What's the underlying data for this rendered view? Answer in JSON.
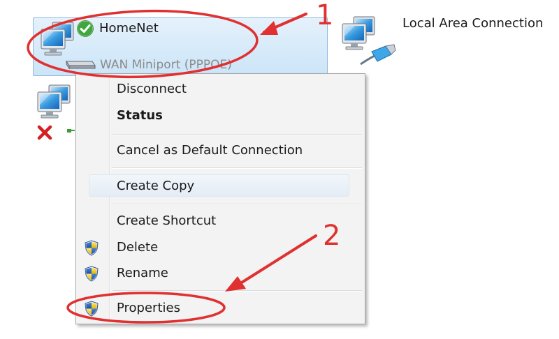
{
  "connections": {
    "selected": {
      "name": "HomeNet",
      "device": "WAN Miniport (PPPOE)",
      "status_icon": "green-check-icon"
    },
    "other": {
      "name": "Local Area Connection",
      "icon": "network-cable-icon"
    },
    "disconnected": {
      "status_icon": "red-x-icon"
    }
  },
  "context_menu": {
    "items": [
      {
        "label": "Disconnect"
      },
      {
        "label": "Status"
      },
      {
        "label": "Cancel as Default Connection"
      },
      {
        "label": "Create Copy"
      },
      {
        "label": "Create Shortcut"
      },
      {
        "label": "Delete",
        "icon": "uac-shield-icon"
      },
      {
        "label": "Rename",
        "icon": "uac-shield-icon"
      },
      {
        "label": "Properties",
        "icon": "uac-shield-icon"
      }
    ]
  },
  "annotations": {
    "step1": "1",
    "step2": "2",
    "color": "#e03030"
  }
}
